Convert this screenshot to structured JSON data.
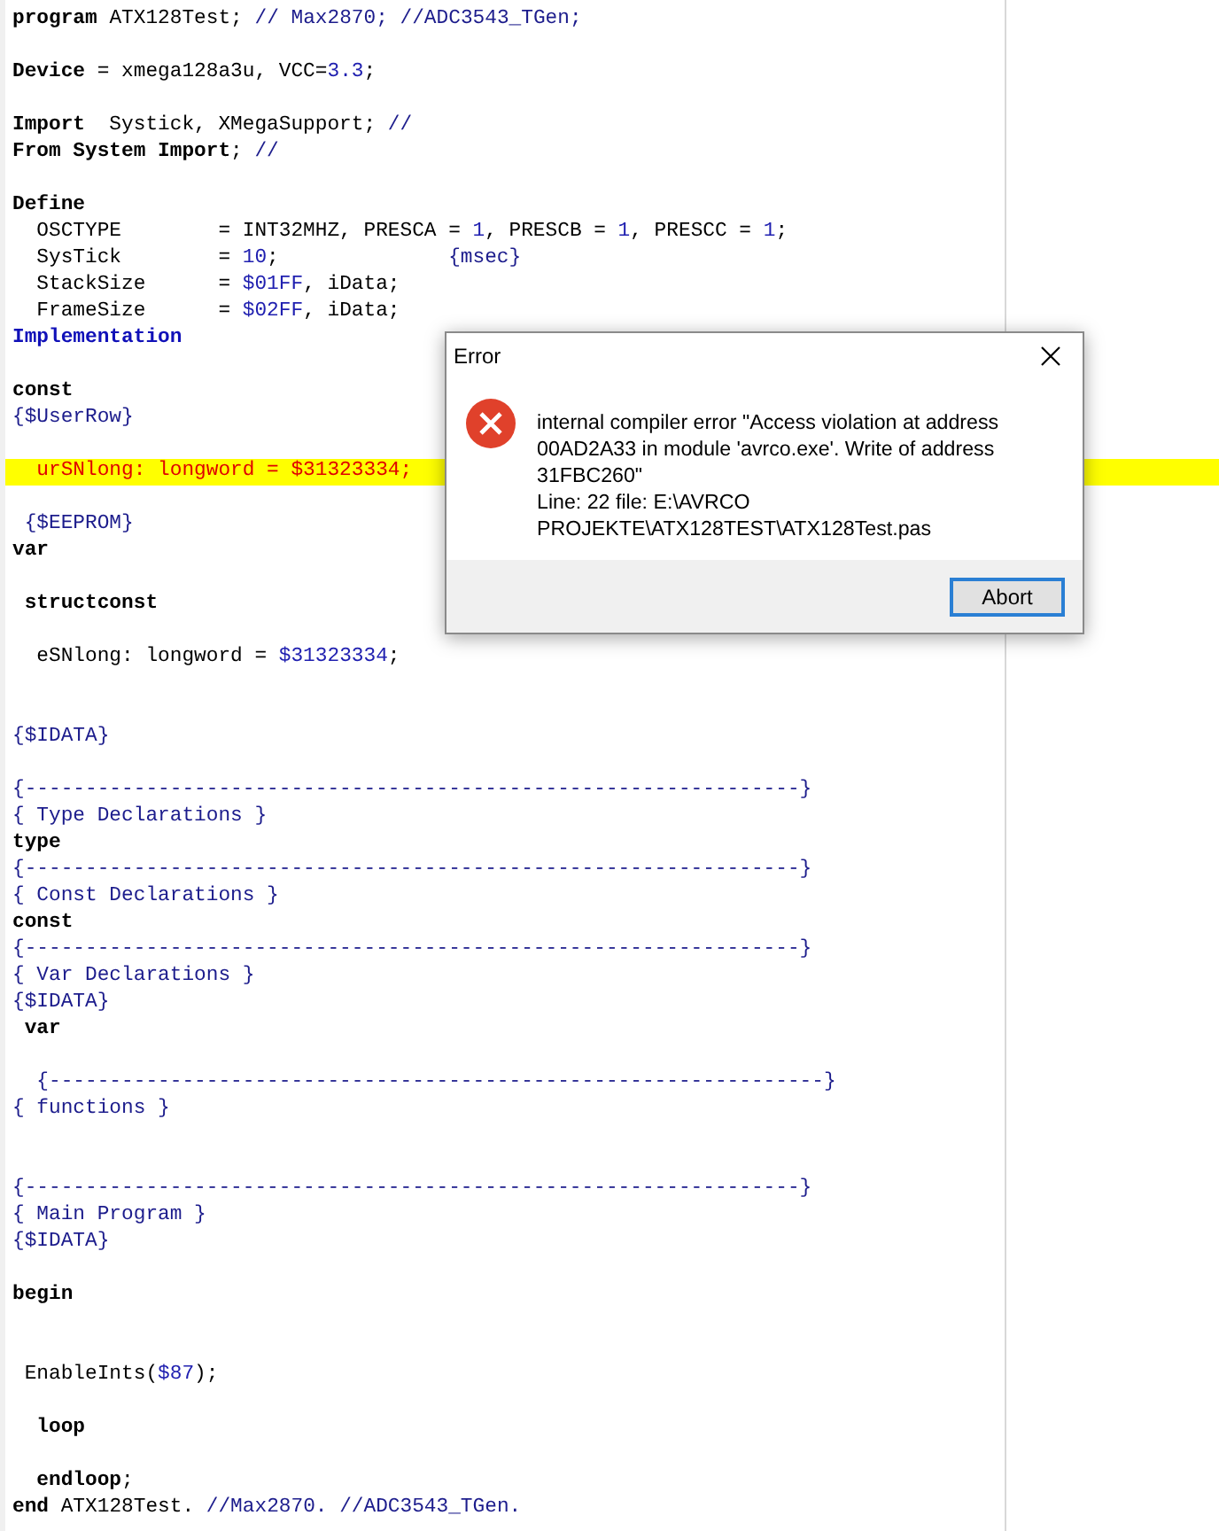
{
  "editor": {
    "lines": [
      {
        "highlighted": false,
        "segments": [
          {
            "kind": "keyword",
            "text": "program"
          },
          {
            "kind": "plain",
            "text": " ATX128Test; "
          },
          {
            "kind": "comment",
            "text": "// Max2870; //ADC3543_TGen;"
          }
        ]
      },
      {
        "highlighted": false
      },
      {
        "highlighted": false,
        "segments": [
          {
            "kind": "keyword",
            "text": "Device"
          },
          {
            "kind": "plain",
            "text": " = xmega128a3u, VCC="
          },
          {
            "kind": "number",
            "text": "3.3"
          },
          {
            "kind": "plain",
            "text": ";"
          }
        ]
      },
      {
        "highlighted": false
      },
      {
        "highlighted": false,
        "segments": [
          {
            "kind": "keyword",
            "text": "Import"
          },
          {
            "kind": "plain",
            "text": "  Systick, XMegaSupport; "
          },
          {
            "kind": "comment",
            "text": "//"
          }
        ]
      },
      {
        "highlighted": false,
        "segments": [
          {
            "kind": "keyword",
            "text": "From System Import"
          },
          {
            "kind": "plain",
            "text": "; "
          },
          {
            "kind": "comment",
            "text": "//"
          }
        ]
      },
      {
        "highlighted": false
      },
      {
        "highlighted": false,
        "segments": [
          {
            "kind": "keyword",
            "text": "Define"
          }
        ]
      },
      {
        "highlighted": false,
        "segments": [
          {
            "kind": "plain",
            "text": "  OSCTYPE        = INT32MHZ, PRESCA = "
          },
          {
            "kind": "number",
            "text": "1"
          },
          {
            "kind": "plain",
            "text": ", PRESCB = "
          },
          {
            "kind": "number",
            "text": "1"
          },
          {
            "kind": "plain",
            "text": ", PRESCC = "
          },
          {
            "kind": "number",
            "text": "1"
          },
          {
            "kind": "plain",
            "text": ";"
          }
        ]
      },
      {
        "highlighted": false,
        "segments": [
          {
            "kind": "plain",
            "text": "  SysTick        = "
          },
          {
            "kind": "number",
            "text": "10"
          },
          {
            "kind": "plain",
            "text": ";              "
          },
          {
            "kind": "comment",
            "text": "{msec}"
          }
        ]
      },
      {
        "highlighted": false,
        "segments": [
          {
            "kind": "plain",
            "text": "  StackSize      = "
          },
          {
            "kind": "number",
            "text": "$01FF"
          },
          {
            "kind": "plain",
            "text": ", iData;"
          }
        ]
      },
      {
        "highlighted": false,
        "segments": [
          {
            "kind": "plain",
            "text": "  FrameSize      = "
          },
          {
            "kind": "number",
            "text": "$02FF"
          },
          {
            "kind": "plain",
            "text": ", iData;"
          }
        ]
      },
      {
        "highlighted": false,
        "segments": [
          {
            "kind": "section",
            "text": "Implementation"
          }
        ]
      },
      {
        "highlighted": false
      },
      {
        "highlighted": false,
        "segments": [
          {
            "kind": "keyword",
            "text": "const"
          }
        ]
      },
      {
        "highlighted": false,
        "segments": [
          {
            "kind": "comment",
            "text": "{$UserRow}"
          }
        ]
      },
      {
        "highlighted": false
      },
      {
        "highlighted": true,
        "segments": [
          {
            "kind": "plain",
            "text": "  urSNlong: longword = "
          },
          {
            "kind": "number",
            "text": "$31323334"
          },
          {
            "kind": "plain",
            "text": ";"
          }
        ]
      },
      {
        "highlighted": false
      },
      {
        "highlighted": false,
        "segments": [
          {
            "kind": "comment",
            "text": " {$EEPROM}"
          }
        ]
      },
      {
        "highlighted": false,
        "segments": [
          {
            "kind": "keyword",
            "text": "var"
          }
        ]
      },
      {
        "highlighted": false
      },
      {
        "highlighted": false,
        "segments": [
          {
            "kind": "keyword",
            "text": " structconst"
          }
        ]
      },
      {
        "highlighted": false
      },
      {
        "highlighted": false,
        "segments": [
          {
            "kind": "plain",
            "text": "  eSNlong: longword = "
          },
          {
            "kind": "number",
            "text": "$31323334"
          },
          {
            "kind": "plain",
            "text": ";"
          }
        ]
      },
      {
        "highlighted": false
      },
      {
        "highlighted": false
      },
      {
        "highlighted": false,
        "segments": [
          {
            "kind": "comment",
            "text": "{$IDATA}"
          }
        ]
      },
      {
        "highlighted": false
      },
      {
        "highlighted": false,
        "segments": [
          {
            "kind": "comment",
            "text": "{----------------------------------------------------------------}"
          }
        ]
      },
      {
        "highlighted": false,
        "segments": [
          {
            "kind": "comment",
            "text": "{ Type Declarations }"
          }
        ]
      },
      {
        "highlighted": false,
        "segments": [
          {
            "kind": "keyword",
            "text": "type"
          }
        ]
      },
      {
        "highlighted": false,
        "segments": [
          {
            "kind": "comment",
            "text": "{----------------------------------------------------------------}"
          }
        ]
      },
      {
        "highlighted": false,
        "segments": [
          {
            "kind": "comment",
            "text": "{ Const Declarations }"
          }
        ]
      },
      {
        "highlighted": false,
        "segments": [
          {
            "kind": "keyword",
            "text": "const"
          }
        ]
      },
      {
        "highlighted": false,
        "segments": [
          {
            "kind": "comment",
            "text": "{----------------------------------------------------------------}"
          }
        ]
      },
      {
        "highlighted": false,
        "segments": [
          {
            "kind": "comment",
            "text": "{ Var Declarations }"
          }
        ]
      },
      {
        "highlighted": false,
        "segments": [
          {
            "kind": "comment",
            "text": "{$IDATA}"
          }
        ]
      },
      {
        "highlighted": false,
        "segments": [
          {
            "kind": "keyword",
            "text": " var"
          }
        ]
      },
      {
        "highlighted": false
      },
      {
        "highlighted": false,
        "segments": [
          {
            "kind": "comment",
            "text": "  {----------------------------------------------------------------}"
          }
        ]
      },
      {
        "highlighted": false,
        "segments": [
          {
            "kind": "comment",
            "text": "{ functions }"
          }
        ]
      },
      {
        "highlighted": false
      },
      {
        "highlighted": false
      },
      {
        "highlighted": false,
        "segments": [
          {
            "kind": "comment",
            "text": "{----------------------------------------------------------------}"
          }
        ]
      },
      {
        "highlighted": false,
        "segments": [
          {
            "kind": "comment",
            "text": "{ Main Program }"
          }
        ]
      },
      {
        "highlighted": false,
        "segments": [
          {
            "kind": "comment",
            "text": "{$IDATA}"
          }
        ]
      },
      {
        "highlighted": false
      },
      {
        "highlighted": false,
        "segments": [
          {
            "kind": "keyword",
            "text": "begin"
          }
        ]
      },
      {
        "highlighted": false
      },
      {
        "highlighted": false
      },
      {
        "highlighted": false,
        "segments": [
          {
            "kind": "plain",
            "text": " EnableInts("
          },
          {
            "kind": "number",
            "text": "$87"
          },
          {
            "kind": "plain",
            "text": ");"
          }
        ]
      },
      {
        "highlighted": false
      },
      {
        "highlighted": false,
        "segments": [
          {
            "kind": "keyword",
            "text": "  loop"
          }
        ]
      },
      {
        "highlighted": false
      },
      {
        "highlighted": false,
        "segments": [
          {
            "kind": "keyword",
            "text": "  endloop"
          },
          {
            "kind": "plain",
            "text": ";"
          }
        ]
      },
      {
        "highlighted": false,
        "segments": [
          {
            "kind": "keyword",
            "text": "end"
          },
          {
            "kind": "plain",
            "text": " ATX128Test. "
          },
          {
            "kind": "comment",
            "text": "//Max2870. //ADC3543_TGen."
          }
        ]
      }
    ]
  },
  "dialog": {
    "title": "Error",
    "message": "internal compiler error \"Access violation at address\n00AD2A33 in module 'avrco.exe'. Write of address\n31FBC260\"\nLine: 22 file: E:\\AVRCO\nPROJEKTE\\ATX128TEST\\ATX128Test.pas",
    "buttons": [
      "Abort"
    ]
  }
}
